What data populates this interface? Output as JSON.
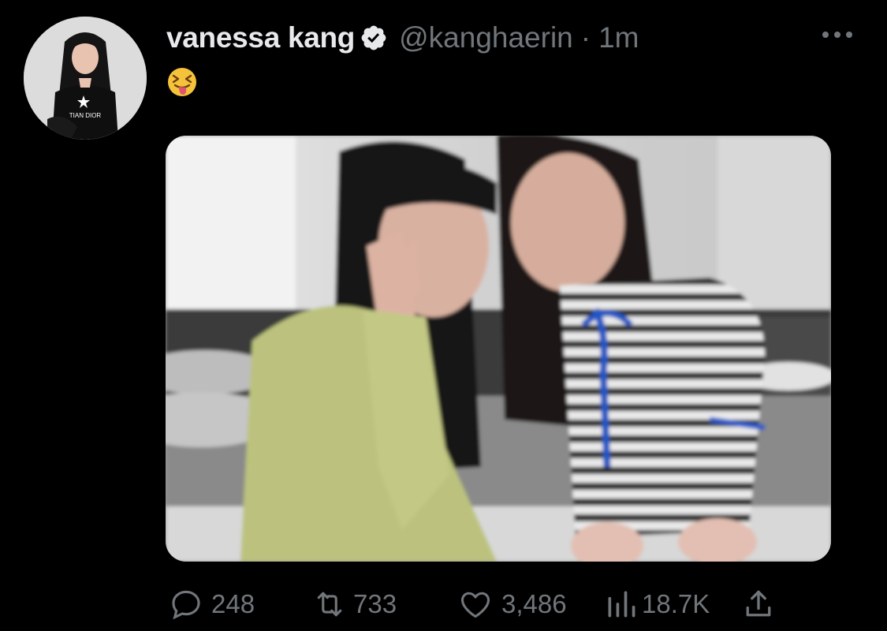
{
  "tweet": {
    "display_name": "vanessa kang",
    "handle": "@kanghaerin",
    "separator": "·",
    "time": "1m",
    "text_emoji": "squinting-face-with-tongue",
    "avatar_shirt_text": "TIAN DIOR"
  },
  "actions": {
    "reply_count": "248",
    "retweet_count": "733",
    "like_count": "3,486",
    "views_count": "18.7K"
  },
  "icons": {
    "verified": "verified-badge-icon",
    "more": "more-options-icon",
    "reply": "reply-icon",
    "retweet": "retweet-icon",
    "like": "like-icon",
    "views": "views-icon",
    "share": "share-icon"
  },
  "colors": {
    "background": "#000000",
    "primary_text": "#e7e9ea",
    "secondary_text": "#71767b",
    "emoji_yellow": "#f5c33b"
  }
}
